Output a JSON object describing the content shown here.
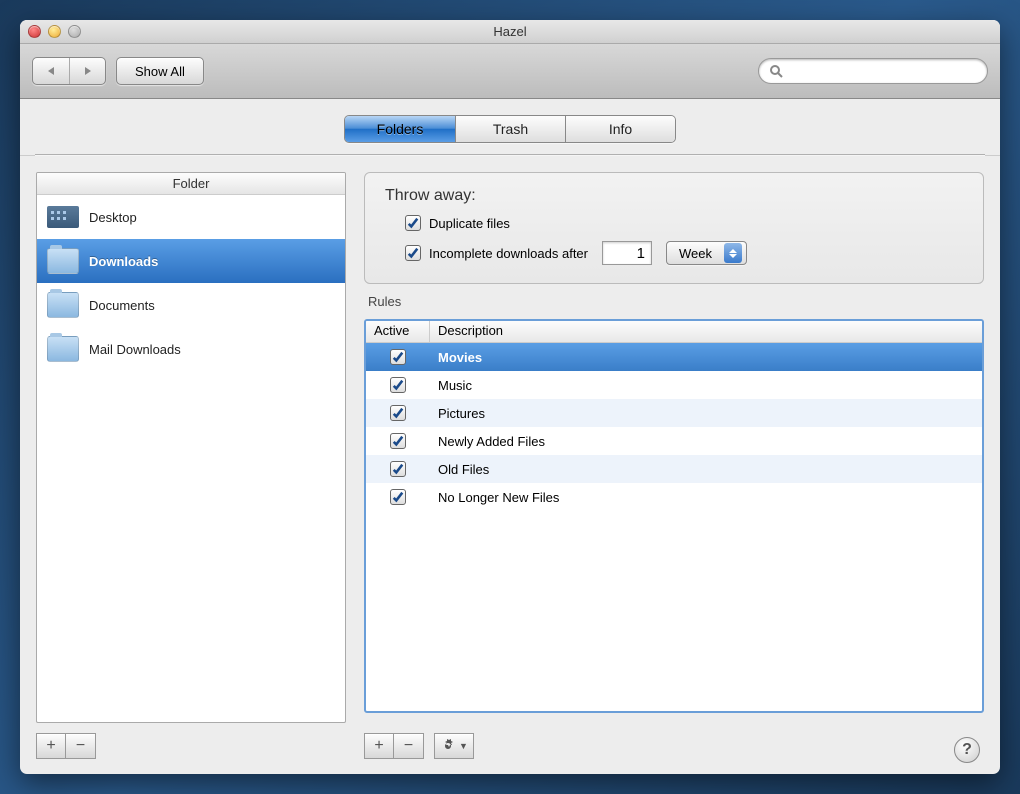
{
  "window": {
    "title": "Hazel"
  },
  "toolbar": {
    "show_all_label": "Show All",
    "search_placeholder": ""
  },
  "tabs": {
    "items": [
      {
        "label": "Folders",
        "active": true
      },
      {
        "label": "Trash",
        "active": false
      },
      {
        "label": "Info",
        "active": false
      }
    ]
  },
  "sidebar": {
    "header": "Folder",
    "folders": [
      {
        "name": "Desktop",
        "icon": "desk",
        "selected": false
      },
      {
        "name": "Downloads",
        "icon": "folder",
        "selected": true
      },
      {
        "name": "Documents",
        "icon": "folder",
        "selected": false
      },
      {
        "name": "Mail Downloads",
        "icon": "folder",
        "selected": false
      }
    ]
  },
  "throw": {
    "title": "Throw away:",
    "duplicate_label": "Duplicate files",
    "duplicate_checked": true,
    "incomplete_label": "Incomplete downloads after",
    "incomplete_checked": true,
    "incomplete_value": "1",
    "incomplete_unit": "Week"
  },
  "rules": {
    "label": "Rules",
    "col_active": "Active",
    "col_desc": "Description",
    "items": [
      {
        "name": "Movies",
        "active": true,
        "selected": true
      },
      {
        "name": "Music",
        "active": true,
        "selected": false
      },
      {
        "name": "Pictures",
        "active": true,
        "selected": false
      },
      {
        "name": "Newly Added Files",
        "active": true,
        "selected": false
      },
      {
        "name": "Old Files",
        "active": true,
        "selected": false
      },
      {
        "name": "No Longer New Files",
        "active": true,
        "selected": false
      }
    ]
  }
}
